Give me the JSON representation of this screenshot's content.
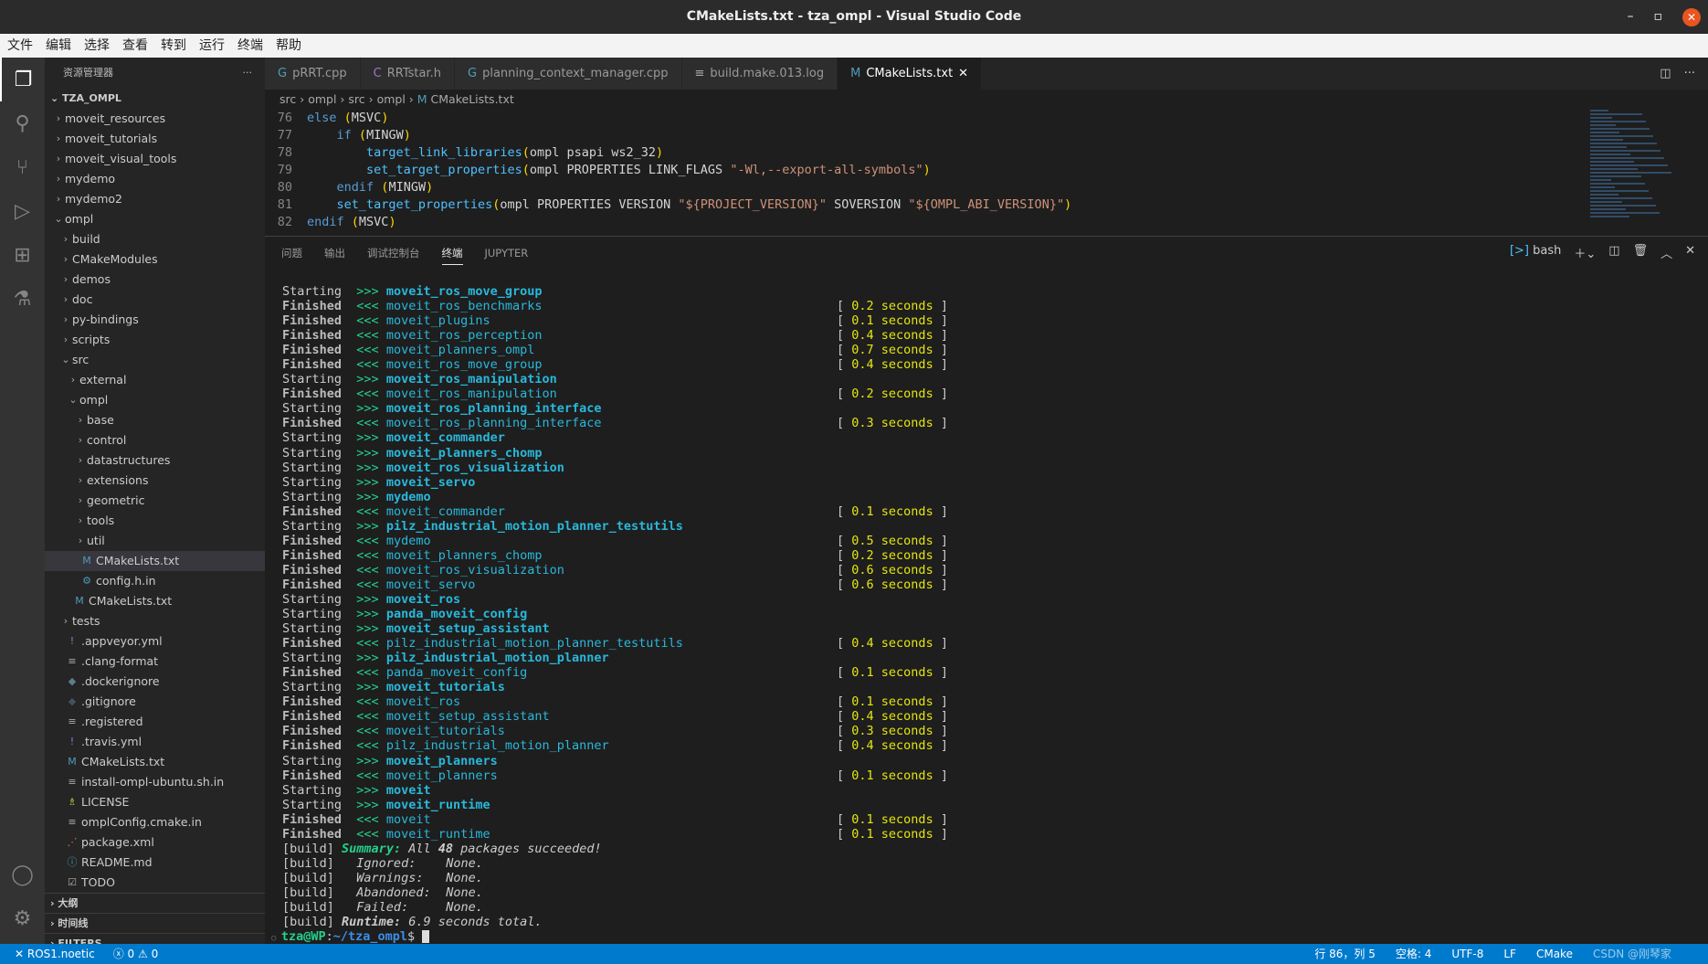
{
  "window": {
    "title": "CMakeLists.txt - tza_ompl - Visual Studio Code"
  },
  "menu": [
    "文件",
    "编辑",
    "选择",
    "查看",
    "转到",
    "运行",
    "终端",
    "帮助"
  ],
  "sidebar": {
    "title": "资源管理器",
    "root": "TZA_OMPL",
    "items": [
      {
        "label": "moveit_resources",
        "depth": 1,
        "type": "folder"
      },
      {
        "label": "moveit_tutorials",
        "depth": 1,
        "type": "folder"
      },
      {
        "label": "moveit_visual_tools",
        "depth": 1,
        "type": "folder"
      },
      {
        "label": "mydemo",
        "depth": 1,
        "type": "folder"
      },
      {
        "label": "mydemo2",
        "depth": 1,
        "type": "folder"
      },
      {
        "label": "ompl",
        "depth": 1,
        "type": "open"
      },
      {
        "label": "build",
        "depth": 2,
        "type": "folder"
      },
      {
        "label": "CMakeModules",
        "depth": 2,
        "type": "folder"
      },
      {
        "label": "demos",
        "depth": 2,
        "type": "folder"
      },
      {
        "label": "doc",
        "depth": 2,
        "type": "folder"
      },
      {
        "label": "py-bindings",
        "depth": 2,
        "type": "folder"
      },
      {
        "label": "scripts",
        "depth": 2,
        "type": "folder"
      },
      {
        "label": "src",
        "depth": 2,
        "type": "open"
      },
      {
        "label": "external",
        "depth": 3,
        "type": "folder"
      },
      {
        "label": "ompl",
        "depth": 3,
        "type": "open"
      },
      {
        "label": "base",
        "depth": 4,
        "type": "folder"
      },
      {
        "label": "control",
        "depth": 4,
        "type": "folder"
      },
      {
        "label": "datastructures",
        "depth": 4,
        "type": "folder"
      },
      {
        "label": "extensions",
        "depth": 4,
        "type": "folder"
      },
      {
        "label": "geometric",
        "depth": 4,
        "type": "folder"
      },
      {
        "label": "tools",
        "depth": 4,
        "type": "folder"
      },
      {
        "label": "util",
        "depth": 4,
        "type": "folder"
      },
      {
        "label": "CMakeLists.txt",
        "depth": 4,
        "type": "file",
        "icon": "M",
        "color": "#519aba",
        "selected": true
      },
      {
        "label": "config.h.in",
        "depth": 4,
        "type": "file",
        "icon": "⚙",
        "color": "#519aba"
      },
      {
        "label": "CMakeLists.txt",
        "depth": 3,
        "type": "file",
        "icon": "M",
        "color": "#519aba"
      },
      {
        "label": "tests",
        "depth": 2,
        "type": "folder"
      },
      {
        "label": ".appveyor.yml",
        "depth": 2,
        "type": "file",
        "icon": "!",
        "color": "#a074c4"
      },
      {
        "label": ".clang-format",
        "depth": 2,
        "type": "file",
        "icon": "≡",
        "color": "#aaaaaa"
      },
      {
        "label": ".dockerignore",
        "depth": 2,
        "type": "file",
        "icon": "◆",
        "color": "#607d8b"
      },
      {
        "label": ".gitignore",
        "depth": 2,
        "type": "file",
        "icon": "◆",
        "color": "#41535b"
      },
      {
        "label": ".registered",
        "depth": 2,
        "type": "file",
        "icon": "≡",
        "color": "#aaaaaa"
      },
      {
        "label": ".travis.yml",
        "depth": 2,
        "type": "file",
        "icon": "!",
        "color": "#a074c4"
      },
      {
        "label": "CMakeLists.txt",
        "depth": 2,
        "type": "file",
        "icon": "M",
        "color": "#519aba"
      },
      {
        "label": "install-ompl-ubuntu.sh.in",
        "depth": 2,
        "type": "file",
        "icon": "≡",
        "color": "#aaaaaa"
      },
      {
        "label": "LICENSE",
        "depth": 2,
        "type": "file",
        "icon": "♗",
        "color": "#cbcb41"
      },
      {
        "label": "omplConfig.cmake.in",
        "depth": 2,
        "type": "file",
        "icon": "≡",
        "color": "#aaaaaa"
      },
      {
        "label": "package.xml",
        "depth": 2,
        "type": "file",
        "icon": "⋰",
        "color": "#e37933"
      },
      {
        "label": "README.md",
        "depth": 2,
        "type": "file",
        "icon": "ⓘ",
        "color": "#519aba"
      },
      {
        "label": "TODO",
        "depth": 2,
        "type": "file",
        "icon": "☑",
        "color": "#aaaaaa"
      }
    ],
    "sections": [
      "大纲",
      "时间线",
      "FILTERS"
    ]
  },
  "tabs": [
    {
      "label": "pRRT.cpp",
      "icon": "G",
      "color": "#519aba"
    },
    {
      "label": "RRTstar.h",
      "icon": "C",
      "color": "#a074c4"
    },
    {
      "label": "planning_context_manager.cpp",
      "icon": "G",
      "color": "#519aba"
    },
    {
      "label": "build.make.013.log",
      "icon": "≡",
      "color": "#aaaaaa"
    },
    {
      "label": "CMakeLists.txt",
      "icon": "M",
      "color": "#519aba",
      "active": true
    }
  ],
  "breadcrumb": [
    "src",
    "ompl",
    "src",
    "ompl",
    "CMakeLists.txt"
  ],
  "code": [
    {
      "n": "76",
      "html": "<span class='kw'>else</span> <span class='par'>(</span><span class='tx'>MSVC</span><span class='par'>)</span>"
    },
    {
      "n": "77",
      "html": "    <span class='kw'>if</span> <span class='par'>(</span><span class='tx'>MINGW</span><span class='par'>)</span>"
    },
    {
      "n": "78",
      "html": "        <span class='fn'>target_link_libraries</span><span class='par'>(</span><span class='tx'>ompl psapi ws2_32</span><span class='par'>)</span>"
    },
    {
      "n": "79",
      "html": "        <span class='fn'>set_target_properties</span><span class='par'>(</span><span class='tx'>ompl PROPERTIES LINK_FLAGS </span><span class='str'>\"-Wl,--export-all-symbols\"</span><span class='par'>)</span>"
    },
    {
      "n": "80",
      "html": "    <span class='kw'>endif</span> <span class='par'>(</span><span class='tx'>MINGW</span><span class='par'>)</span>"
    },
    {
      "n": "81",
      "html": "    <span class='fn'>set_target_properties</span><span class='par'>(</span><span class='tx'>ompl PROPERTIES VERSION </span><span class='str'>\"${PROJECT_VERSION}\"</span><span class='tx'> SOVERSION </span><span class='str'>\"${OMPL_ABI_VERSION}\"</span><span class='par'>)</span>"
    },
    {
      "n": "82",
      "html": "<span class='kw'>endif</span> <span class='par'>(</span><span class='tx'>MSVC</span><span class='par'>)</span>"
    }
  ],
  "panel": {
    "tabs": [
      "问题",
      "输出",
      "调试控制台",
      "终端",
      "JUPYTER"
    ],
    "active": 3,
    "shell": "bash"
  },
  "terminal": [
    [
      "Starting",
      "moveit_ros_move_group",
      ""
    ],
    [
      "Finished",
      "moveit_ros_benchmarks",
      "0.2"
    ],
    [
      "Finished",
      "moveit_plugins",
      "0.1"
    ],
    [
      "Finished",
      "moveit_ros_perception",
      "0.4"
    ],
    [
      "Finished",
      "moveit_planners_ompl",
      "0.7"
    ],
    [
      "Finished",
      "moveit_ros_move_group",
      "0.4"
    ],
    [
      "Starting",
      "moveit_ros_manipulation",
      ""
    ],
    [
      "Finished",
      "moveit_ros_manipulation",
      "0.2"
    ],
    [
      "Starting",
      "moveit_ros_planning_interface",
      ""
    ],
    [
      "Finished",
      "moveit_ros_planning_interface",
      "0.3"
    ],
    [
      "Starting",
      "moveit_commander",
      ""
    ],
    [
      "Starting",
      "moveit_planners_chomp",
      ""
    ],
    [
      "Starting",
      "moveit_ros_visualization",
      ""
    ],
    [
      "Starting",
      "moveit_servo",
      ""
    ],
    [
      "Starting",
      "mydemo",
      ""
    ],
    [
      "Finished",
      "moveit_commander",
      "0.1"
    ],
    [
      "Starting",
      "pilz_industrial_motion_planner_testutils",
      ""
    ],
    [
      "Finished",
      "mydemo",
      "0.5"
    ],
    [
      "Finished",
      "moveit_planners_chomp",
      "0.2"
    ],
    [
      "Finished",
      "moveit_ros_visualization",
      "0.6"
    ],
    [
      "Finished",
      "moveit_servo",
      "0.6"
    ],
    [
      "Starting",
      "moveit_ros",
      ""
    ],
    [
      "Starting",
      "panda_moveit_config",
      ""
    ],
    [
      "Starting",
      "moveit_setup_assistant",
      ""
    ],
    [
      "Finished",
      "pilz_industrial_motion_planner_testutils",
      "0.4"
    ],
    [
      "Starting",
      "pilz_industrial_motion_planner",
      ""
    ],
    [
      "Finished",
      "panda_moveit_config",
      "0.1"
    ],
    [
      "Starting",
      "moveit_tutorials",
      ""
    ],
    [
      "Finished",
      "moveit_ros",
      "0.1"
    ],
    [
      "Finished",
      "moveit_setup_assistant",
      "0.4"
    ],
    [
      "Finished",
      "moveit_tutorials",
      "0.3"
    ],
    [
      "Finished",
      "pilz_industrial_motion_planner",
      "0.4"
    ],
    [
      "Starting",
      "moveit_planners",
      ""
    ],
    [
      "Finished",
      "moveit_planners",
      "0.1"
    ],
    [
      "Starting",
      "moveit",
      ""
    ],
    [
      "Starting",
      "moveit_runtime",
      ""
    ],
    [
      "Finished",
      "moveit",
      "0.1"
    ],
    [
      "Finished",
      "moveit_runtime",
      "0.1"
    ]
  ],
  "seconds_word": "seconds",
  "summary": {
    "prefix": "[build]",
    "label": "Summary:",
    "text1": "All",
    "count": "48",
    "text2": "packages succeeded!",
    "rows": [
      [
        "Ignored:",
        "None."
      ],
      [
        "Warnings:",
        "None."
      ],
      [
        "Abandoned:",
        "None."
      ],
      [
        "Failed:",
        "None."
      ]
    ],
    "runtime_label": "Runtime:",
    "runtime": "6.9 seconds total."
  },
  "prompt": {
    "user": "tza@WP",
    "path": "~/tza_ompl",
    "sym": "$"
  },
  "status": {
    "remote": "ROS1.noetic",
    "errors": "0",
    "warnings": "0",
    "position": "行 86，列 5",
    "spaces": "空格: 4",
    "encoding": "UTF-8",
    "eol": "LF",
    "lang": "CMake",
    "watermark": "CSDN @刚琴家"
  }
}
